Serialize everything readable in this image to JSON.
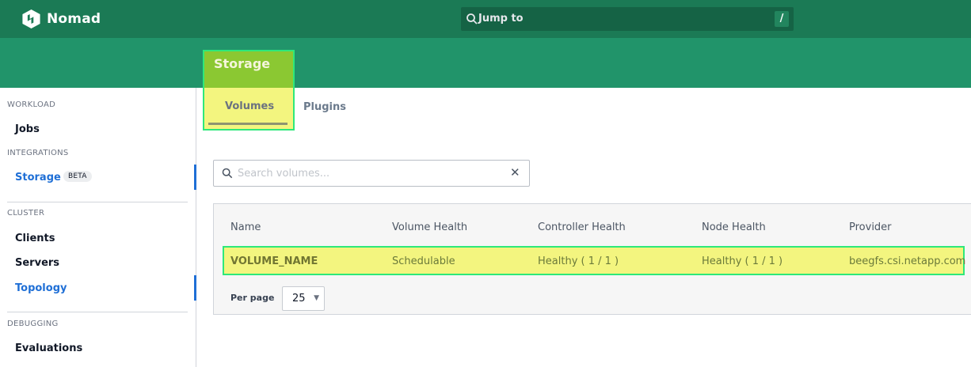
{
  "app": {
    "name": "Nomad"
  },
  "search_bar": {
    "label": "Jump to",
    "shortcut": "/"
  },
  "page": {
    "title": "Storage",
    "tabs": [
      {
        "label": "Volumes",
        "active": true
      },
      {
        "label": "Plugins",
        "active": false
      }
    ]
  },
  "sidebar": {
    "sections": [
      {
        "label": "WORKLOAD",
        "items": [
          {
            "label": "Jobs"
          }
        ]
      },
      {
        "label": "INTEGRATIONS",
        "items": [
          {
            "label": "Storage",
            "badge": "BETA",
            "active": true
          }
        ]
      },
      {
        "label": "CLUSTER",
        "items": [
          {
            "label": "Clients"
          },
          {
            "label": "Servers"
          },
          {
            "label": "Topology",
            "active": true
          }
        ]
      },
      {
        "label": "DEBUGGING",
        "items": [
          {
            "label": "Evaluations"
          }
        ]
      }
    ]
  },
  "volume_search": {
    "placeholder": "Search volumes...",
    "clear_icon": "close-icon"
  },
  "table": {
    "columns": [
      "Name",
      "Volume Health",
      "Controller Health",
      "Node Health",
      "Provider"
    ],
    "rows": [
      {
        "name": "VOLUME_NAME",
        "volume_health": "Schedulable",
        "controller_health": "Healthy ( 1 / 1 )",
        "node_health": "Healthy ( 1 / 1 )",
        "provider": "beegfs.csi.netapp.com"
      }
    ]
  },
  "pagination": {
    "label": "Per page",
    "value": "25"
  },
  "colors": {
    "navbar": "#1b7a55",
    "subheader": "#21946a",
    "active_link": "#1f6fd6",
    "highlight": "#f3f57f"
  }
}
